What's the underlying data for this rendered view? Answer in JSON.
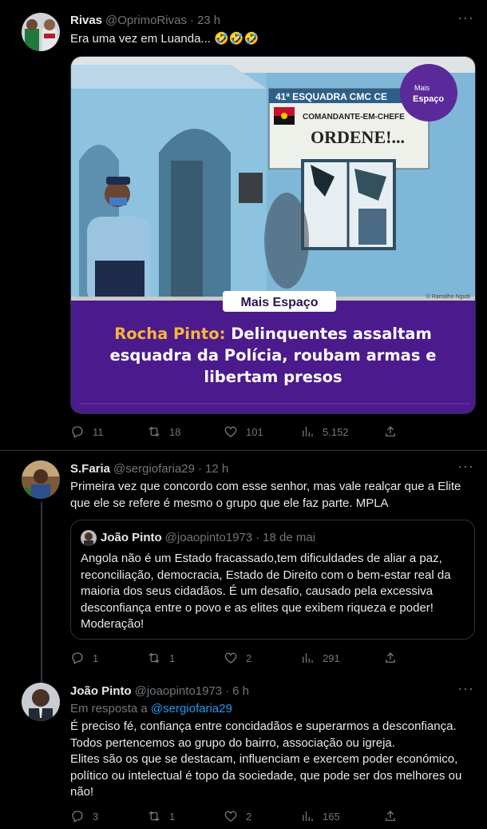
{
  "tweet1": {
    "name": "Rivas",
    "handle": "@OprimoRivas",
    "sep": "·",
    "time": "23 h",
    "more": "···",
    "text": "Era uma vez em Luanda... 🤣🤣🤣",
    "image": {
      "sign_top": "41ª ESQUADRA CMC CE",
      "sign_line1": "COMANDANTE-EM-CHEFE",
      "sign_line2": "ORDENE!...",
      "logo_line1": "Mais",
      "logo_line2": "Espaço",
      "caption_tag": "Mais Espaço",
      "credit": "© Ramalho Ngudi",
      "headline_highlight": "Rocha Pinto:",
      "headline_rest": " Delinquentes assaltam esquadra da Polícia, roubam armas e libertam presos"
    },
    "replies": "11",
    "retweets": "18",
    "likes": "101",
    "views": "5.152"
  },
  "tweet2": {
    "name": "S.Faria",
    "handle": "@sergiofaria29",
    "sep": "·",
    "time": "12 h",
    "more": "···",
    "text": "Primeira vez que concordo com esse senhor, mas vale realçar que a Elite que ele se refere é mesmo o grupo que ele faz parte. MPLA",
    "quote": {
      "name": "João Pinto",
      "handle": "@joaopinto1973",
      "sep": "·",
      "time": "18 de mai",
      "text": "Angola não é um Estado fracassado,tem dificuldades de  aliar a paz, reconciliação,  democracia, Estado de Direito com o bem-estar real da maioria dos seus cidadãos. É um desafio, causado pela excessiva desconfiança entre o povo e as elites que exibem riqueza e poder! Moderação!"
    },
    "replies": "1",
    "retweets": "1",
    "likes": "2",
    "views": "291"
  },
  "tweet3": {
    "name": "João Pinto",
    "handle": "@joaopinto1973",
    "sep": "·",
    "time": "6 h",
    "more": "···",
    "reply_prefix": "Em resposta a ",
    "reply_to": "@sergiofaria29",
    "text": "É preciso fé, confiança entre concidadãos e superarmos a desconfiança. Todos pertencemos ao grupo do bairro, associação ou igreja.\nElites são os que se destacam, influenciam e exercem poder económico, político ou intelectual é topo da sociedade, que pode ser dos melhores ou não!",
    "replies": "3",
    "retweets": "1",
    "likes": "2",
    "views": "165"
  },
  "colors": {
    "background": "#000000",
    "text": "#e7e9ea",
    "muted": "#71767b",
    "link": "#1d9bf0",
    "divider": "#2f3336",
    "banner_purple": "#4b1a8c",
    "headline_orange": "#f7b53b"
  },
  "icons": [
    "reply-icon",
    "retweet-icon",
    "like-icon",
    "views-icon",
    "share-icon",
    "more-icon"
  ]
}
